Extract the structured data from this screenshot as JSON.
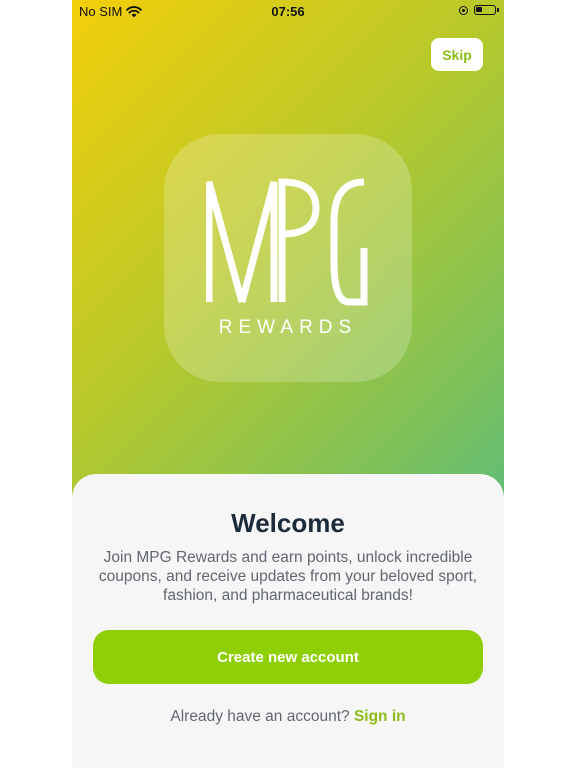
{
  "status_bar": {
    "carrier": "No SIM",
    "time": "07:56"
  },
  "skip_label": "Skip",
  "logo": {
    "mark": "MPG",
    "word": "REWARDS"
  },
  "welcome": {
    "title": "Welcome",
    "body": "Join MPG Rewards and earn points, unlock incredible coupons, and receive updates from your beloved sport, fashion, and pharmaceutical brands!"
  },
  "create_account_label": "Create new account",
  "signin": {
    "prompt": "Already have an account?",
    "link": "Sign in"
  },
  "colors": {
    "accent": "#8fcf06",
    "gradient_start": "#f3cf0a",
    "gradient_end": "#2fb5a8",
    "title": "#1d2a3a"
  }
}
